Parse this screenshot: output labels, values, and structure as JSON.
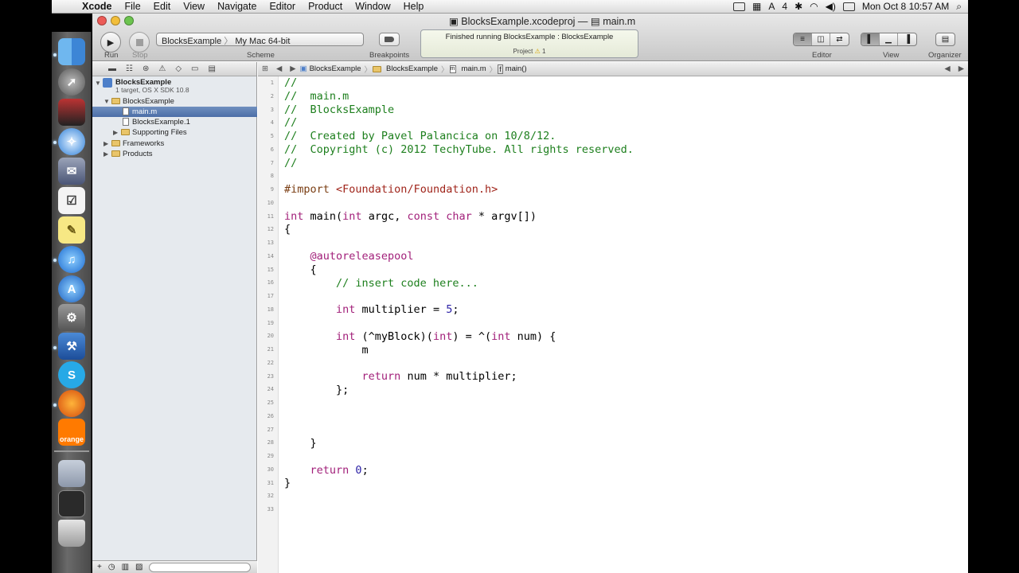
{
  "menubar": {
    "app": "Xcode",
    "items": [
      "File",
      "Edit",
      "View",
      "Navigate",
      "Editor",
      "Product",
      "Window",
      "Help"
    ],
    "battery_number": "4",
    "clock": "Mon Oct 8  10:57 AM"
  },
  "window": {
    "title_project": "BlocksExample.xcodeproj",
    "title_separator": "—",
    "title_file": "main.m"
  },
  "toolbar": {
    "run_label": "Run",
    "stop_label": "Stop",
    "scheme_name": "BlocksExample",
    "scheme_sep": "〉",
    "scheme_destination": "My Mac 64-bit",
    "scheme_label": "Scheme",
    "breakpoints_label": "Breakpoints",
    "activity_message": "Finished running BlocksExample : BlocksExample",
    "activity_project": "Project",
    "activity_warnings": "1",
    "editor_label": "Editor",
    "view_label": "View",
    "organizer_label": "Organizer"
  },
  "navigator": {
    "project_name": "BlocksExample",
    "project_subtitle": "1 target, OS X SDK 10.8",
    "items": [
      {
        "label": "BlocksExample"
      },
      {
        "label": "main.m"
      },
      {
        "label": "BlocksExample.1"
      },
      {
        "label": "Supporting Files"
      },
      {
        "label": "Frameworks"
      },
      {
        "label": "Products"
      }
    ]
  },
  "jumpbar": {
    "crumbs": [
      "BlocksExample",
      "BlocksExample",
      "main.m",
      "main()"
    ]
  },
  "editor": {
    "line_numbers": [
      "1",
      "2",
      "3",
      "4",
      "5",
      "6",
      "7",
      "8",
      "9",
      "10",
      "11",
      "12",
      "13",
      "14",
      "15",
      "16",
      "17",
      "18",
      "19",
      "20",
      "21",
      "22",
      "23",
      "24",
      "25",
      "26",
      "27",
      "28",
      "29",
      "30",
      "31",
      "32",
      "33"
    ],
    "code": {
      "l1": "//",
      "l2": "//  main.m",
      "l3": "//  BlocksExample",
      "l4": "//",
      "l5": "//  Created by Pavel Palancica on 10/8/12.",
      "l6": "//  Copyright (c) 2012 TechyTube. All rights reserved.",
      "l7": "//",
      "l9_kw": "#import",
      "l9_str": " <Foundation/Foundation.h>",
      "l11_a": "int",
      "l11_b": " main(",
      "l11_c": "int",
      "l11_d": " argc, ",
      "l11_e": "const char",
      "l11_f": " * argv[])",
      "l12": "{",
      "l14": "    @autoreleasepool",
      "l15": "    {",
      "l16": "        // insert code here...",
      "l18_kw": "        int",
      "l18_rest": " multiplier = ",
      "l18_num": "5",
      "l18_end": ";",
      "l20_kw": "        int",
      "l20_a": " (^myBlock)(",
      "l20_kw2": "int",
      "l20_b": ") = ^(",
      "l20_kw3": "int",
      "l20_c": " num) {",
      "l21": "            m",
      "l23_kw": "            return",
      "l23_rest": " num * multiplier;",
      "l24": "        };",
      "l28": "    }",
      "l30_kw": "    return",
      "l30_sp": " ",
      "l30_num": "0",
      "l30_end": ";",
      "l31": "}"
    }
  },
  "dock": {
    "items": [
      "finder-icon",
      "launchpad-icon",
      "photo-booth-icon",
      "safari-icon",
      "mail-icon",
      "reminders-icon",
      "notes-icon",
      "itunes-icon",
      "app-store-icon",
      "system-preferences-icon",
      "xcode-icon",
      "skype-icon",
      "firefox-icon",
      "orange-icon",
      "folder-icon",
      "document-icon",
      "trash-icon"
    ],
    "orange_label": "orange"
  }
}
